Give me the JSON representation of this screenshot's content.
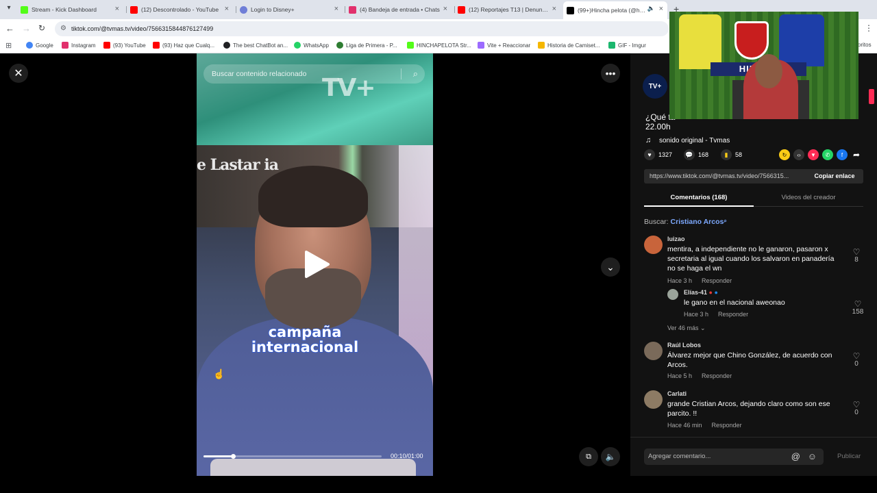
{
  "tabs": [
    {
      "title": "Stream - Kick Dashboard",
      "color": "#53fc18"
    },
    {
      "title": "(12) Descontrolado - YouTube",
      "color": "#ff0000"
    },
    {
      "title": "Login to Disney+",
      "color": "#6f7ed7"
    },
    {
      "title": "(4) Bandeja de entrada • Chats",
      "color": "#e1306c"
    },
    {
      "title": "(12) Reportajes T13 | Denuncias",
      "color": "#ff0000"
    },
    {
      "title": "(99+)Hincha pelota (@hincha",
      "color": "#000000"
    }
  ],
  "address": {
    "url": "tiktok.com/@tvmas.tv/video/7566315844876127499"
  },
  "bookmarks": [
    {
      "label": "Google",
      "color": "#4285f4"
    },
    {
      "label": "Instagram",
      "color": "#e1306c"
    },
    {
      "label": "(93) YouTube",
      "color": "#ff0000"
    },
    {
      "label": "(93) Haz que Cualq...",
      "color": "#ff0000"
    },
    {
      "label": "The best ChatBot an...",
      "color": "#202124"
    },
    {
      "label": "WhatsApp",
      "color": "#25d366"
    },
    {
      "label": "Liga de Primera - P...",
      "color": "#2e7d32"
    },
    {
      "label": "HINCHAPELOTA Str...",
      "color": "#53fc18"
    },
    {
      "label": "Vite + Reaccionar",
      "color": "#9c6bff"
    },
    {
      "label": "Historia de Camiset...",
      "color": "#f5b700"
    },
    {
      "label": "GIF - Imgur",
      "color": "#1bb76e"
    },
    {
      "label": "oritos",
      "color": "#ffffff"
    }
  ],
  "video": {
    "search_placeholder": "Buscar contenido relacionado",
    "overlay_tvplus": "TV+",
    "overlay_wall": "e Lastar ia",
    "caption_line1": "campaña",
    "caption_line2": "internacional",
    "time": "00:10/01:00",
    "progress": 0.167
  },
  "creator": {
    "avatar_text": "TV+",
    "desc_line1": "¿Qué ta",
    "desc_line2": "22.00h",
    "sound": "sonido original - Tvmas"
  },
  "actions": {
    "likes": "1327",
    "comments": "168",
    "saves": "58"
  },
  "link": {
    "url": "https://www.tiktok.com/@tvmas.tv/video/7566315...",
    "copy_label": "Copiar enlace"
  },
  "sidetabs": {
    "comments": "Comentarios (168)",
    "creator_videos": "Videos del creador"
  },
  "search_suggest": {
    "prefix": "Buscar:",
    "keyword": "Cristiano Arcos"
  },
  "comments": [
    {
      "user": "luizao",
      "text": "mentira, a independiente no le ganaron, pasaron x secretaria al igual cuando los salvaron en panadería no se haga el wn",
      "time": "Hace 3 h",
      "reply": "Responder",
      "likes": "8",
      "avatar": "#c8643b"
    },
    {
      "user": "Elías-41",
      "text": "le gano en el nacional aweonao",
      "time": "Hace 3 h",
      "reply": "Responder",
      "likes": "158",
      "avatar": "#9aa39a"
    },
    {
      "user": "Raúl Lobos",
      "text": "Álvarez mejor que Chino González, de acuerdo con Arcos.",
      "time": "Hace 5 h",
      "reply": "Responder",
      "likes": "0",
      "avatar": "#7a6a5a"
    },
    {
      "user": "Carlati",
      "text": "grande Cristian Arcos, dejando claro como son ese parcito. !!",
      "time": "Hace 46 min",
      "reply": "Responder",
      "likes": "0",
      "avatar": "#8d7b64"
    }
  ],
  "view_more": "Ver 46 más",
  "comment_bar": {
    "placeholder": "Agregar comentario...",
    "post": "Publicar"
  },
  "webcam": {
    "banner": "HINCHA"
  }
}
